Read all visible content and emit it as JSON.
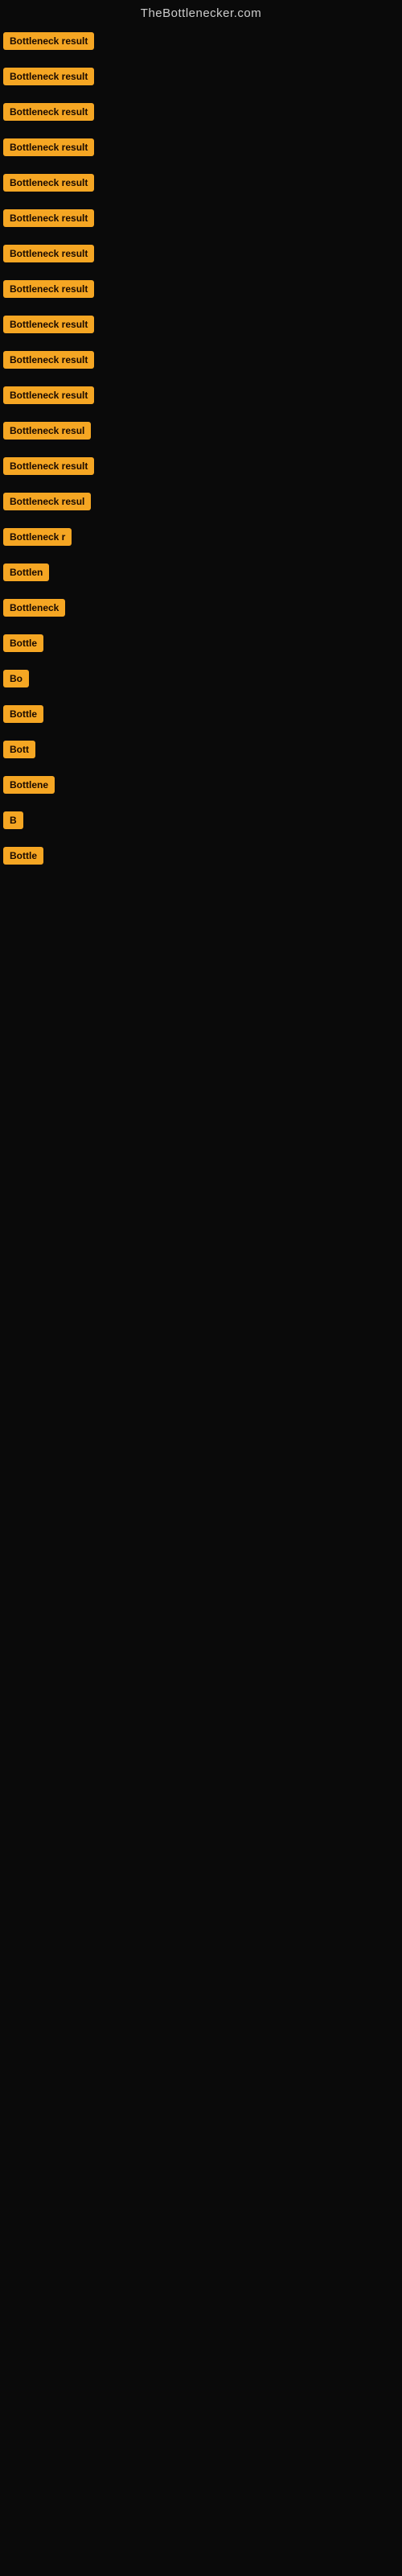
{
  "site": {
    "title": "TheBottlenecker.com"
  },
  "rows": [
    {
      "id": 1,
      "label": "Bottleneck result",
      "badgeClass": "badge-full"
    },
    {
      "id": 2,
      "label": "Bottleneck result",
      "badgeClass": "badge-v1"
    },
    {
      "id": 3,
      "label": "Bottleneck result",
      "badgeClass": "badge-v2"
    },
    {
      "id": 4,
      "label": "Bottleneck result",
      "badgeClass": "badge-v3"
    },
    {
      "id": 5,
      "label": "Bottleneck result",
      "badgeClass": "badge-v4"
    },
    {
      "id": 6,
      "label": "Bottleneck result",
      "badgeClass": "badge-v5"
    },
    {
      "id": 7,
      "label": "Bottleneck result",
      "badgeClass": "badge-v6"
    },
    {
      "id": 8,
      "label": "Bottleneck result",
      "badgeClass": "badge-v7"
    },
    {
      "id": 9,
      "label": "Bottleneck result",
      "badgeClass": "badge-v8"
    },
    {
      "id": 10,
      "label": "Bottleneck result",
      "badgeClass": "badge-v9"
    },
    {
      "id": 11,
      "label": "Bottleneck result",
      "badgeClass": "badge-v10"
    },
    {
      "id": 12,
      "label": "Bottleneck resul",
      "badgeClass": "badge-v11"
    },
    {
      "id": 13,
      "label": "Bottleneck result",
      "badgeClass": "badge-v12"
    },
    {
      "id": 14,
      "label": "Bottleneck resul",
      "badgeClass": "badge-v13"
    },
    {
      "id": 15,
      "label": "Bottleneck r",
      "badgeClass": "badge-v14"
    },
    {
      "id": 16,
      "label": "Bottlen",
      "badgeClass": "badge-v15"
    },
    {
      "id": 17,
      "label": "Bottleneck",
      "badgeClass": "badge-v16"
    },
    {
      "id": 18,
      "label": "Bottle",
      "badgeClass": "badge-v17"
    },
    {
      "id": 19,
      "label": "Bo",
      "badgeClass": "badge-v18"
    },
    {
      "id": 20,
      "label": "Bottle",
      "badgeClass": "badge-v19"
    },
    {
      "id": 21,
      "label": "Bott",
      "badgeClass": "badge-v20"
    },
    {
      "id": 22,
      "label": "Bottlene",
      "badgeClass": "badge-v21"
    },
    {
      "id": 23,
      "label": "B",
      "badgeClass": "badge-v22"
    },
    {
      "id": 24,
      "label": "Bottle",
      "badgeClass": "badge-v23"
    }
  ]
}
